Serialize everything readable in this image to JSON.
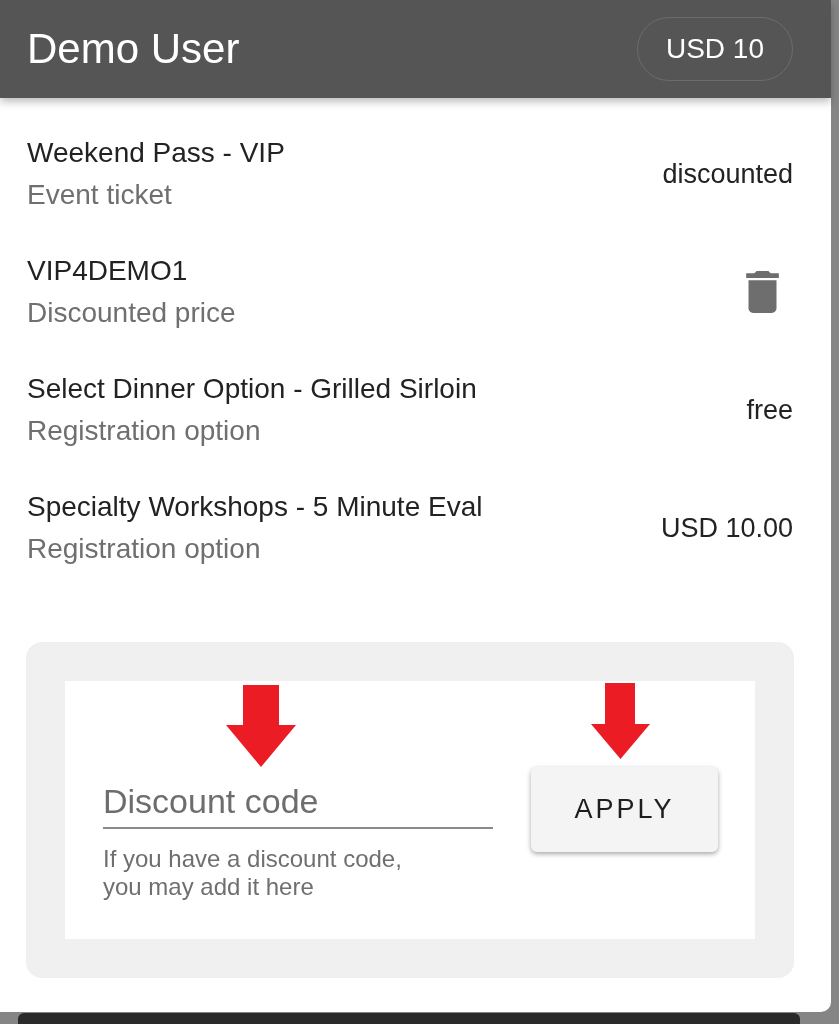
{
  "header": {
    "title": "Demo User",
    "balance": "USD 10"
  },
  "items": [
    {
      "kind": "value",
      "title": "Weekend Pass - VIP",
      "subtitle": "Event ticket",
      "value": "discounted"
    },
    {
      "kind": "delete",
      "title": "VIP4DEMO1",
      "subtitle": "Discounted price"
    },
    {
      "kind": "value",
      "title": "Select Dinner Option - Grilled Sirloin",
      "subtitle": "Registration option",
      "value": "free"
    },
    {
      "kind": "value",
      "title": "Specialty Workshops - 5 Minute Eval",
      "subtitle": "Registration option",
      "value": "USD 10.00"
    }
  ],
  "discount": {
    "placeholder": "Discount code",
    "helper": "If you have a discount code, you may add it here",
    "button": "APPLY"
  }
}
